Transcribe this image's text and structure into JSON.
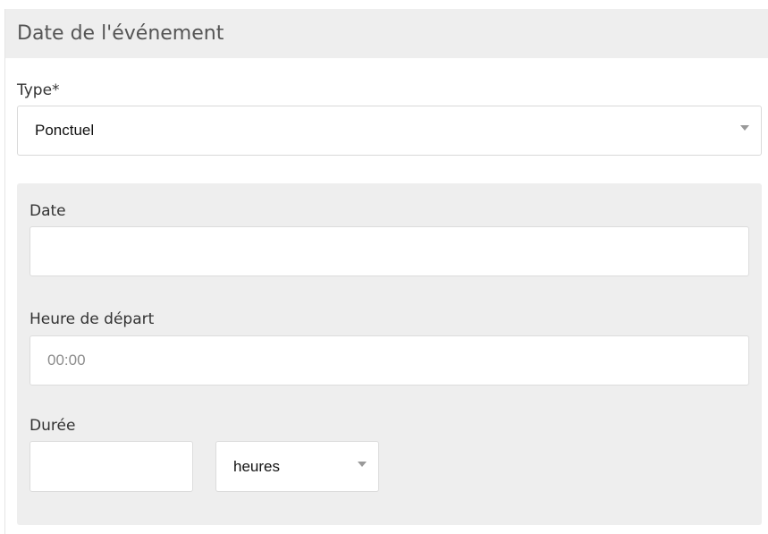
{
  "section": {
    "title": "Date de l'événement"
  },
  "type_field": {
    "label": "Type*",
    "selected": "Ponctuel"
  },
  "schedule": {
    "date": {
      "label": "Date",
      "value": "",
      "placeholder": ""
    },
    "start_time": {
      "label": "Heure de départ",
      "value": "",
      "placeholder": "00:00"
    },
    "duration": {
      "label": "Durée",
      "value": "",
      "unit_selected": "heures"
    }
  },
  "colors": {
    "header_bg": "#eeeeee",
    "panel_bg": "#eeeeee",
    "border": "#d9d9d9",
    "caret": "#999999"
  },
  "icons": {
    "type_select": "caret-down-icon",
    "unit_select": "caret-down-icon"
  }
}
